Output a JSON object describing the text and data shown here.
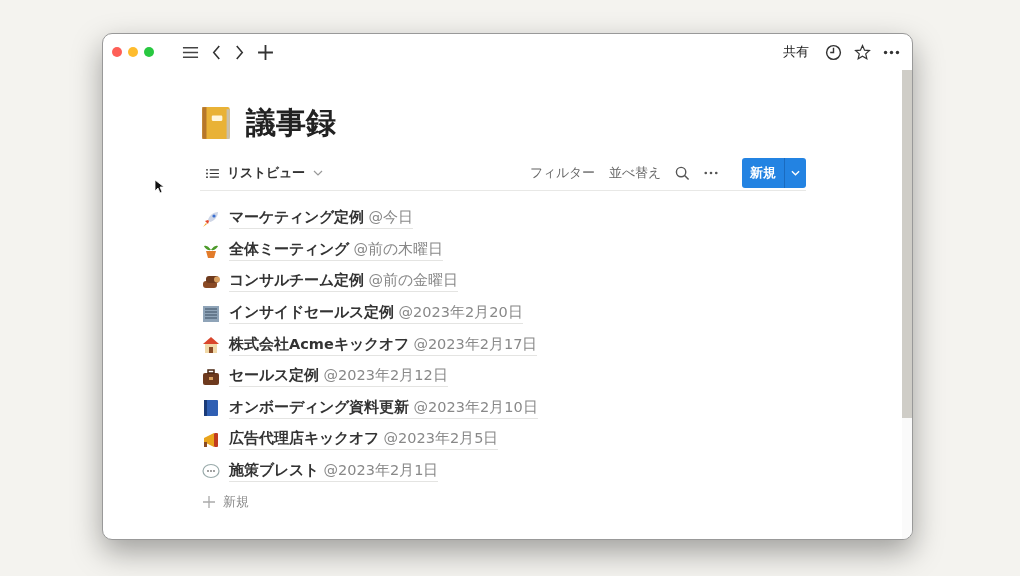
{
  "top_bar": {
    "share": "共有"
  },
  "page": {
    "title": "議事録"
  },
  "view": {
    "label": "リストビュー",
    "filter": "フィルター",
    "sort": "並べ替え",
    "new_button": "新規"
  },
  "items": [
    {
      "title": "マーケティング定例",
      "date": "@今日"
    },
    {
      "title": "全体ミーティング",
      "date": "@前の木曜日"
    },
    {
      "title": "コンサルチーム定例",
      "date": "@前の金曜日"
    },
    {
      "title": "インサイドセールス定例",
      "date": "@2023年2月20日"
    },
    {
      "title": "株式会社Acmeキックオフ",
      "date": "@2023年2月17日"
    },
    {
      "title": "セールス定例",
      "date": "@2023年2月12日"
    },
    {
      "title": "オンボーディング資料更新",
      "date": "@2023年2月10日"
    },
    {
      "title": "広告代理店キックオフ",
      "date": "@2023年2月5日"
    },
    {
      "title": "施策ブレスト",
      "date": "@2023年2月1日"
    }
  ],
  "add_row": {
    "label": "新規"
  }
}
